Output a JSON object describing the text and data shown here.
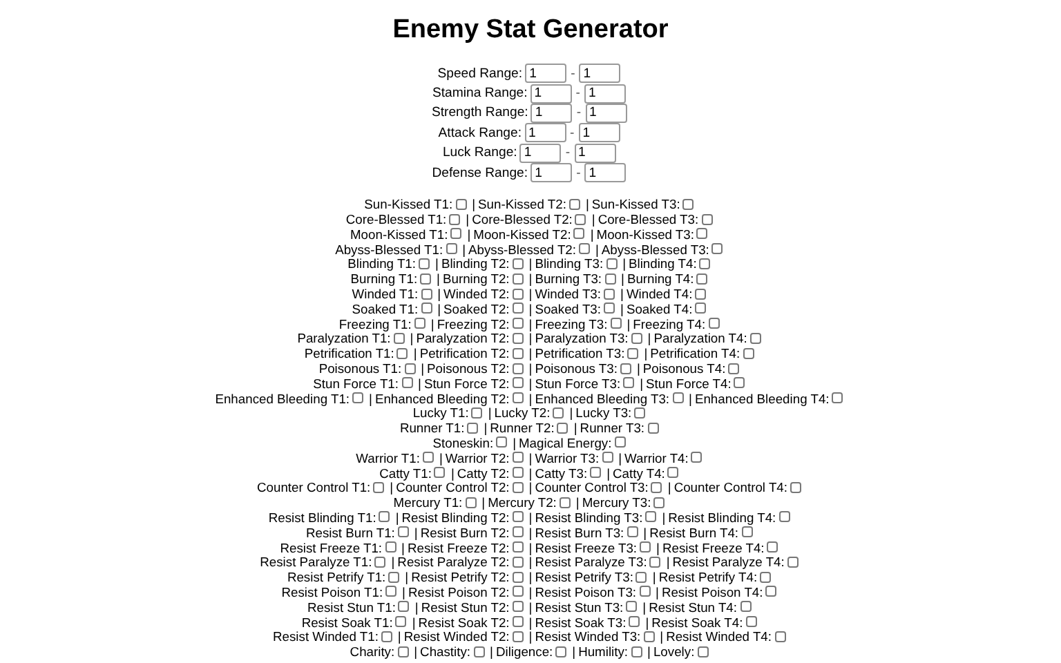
{
  "title": "Enemy Stat Generator",
  "range_dash": "-",
  "ranges": [
    {
      "label": "Speed Range:",
      "min": "1",
      "max": "1"
    },
    {
      "label": "Stamina Range:",
      "min": "1",
      "max": "1"
    },
    {
      "label": "Strength Range:",
      "min": "1",
      "max": "1"
    },
    {
      "label": "Attack Range:",
      "min": "1",
      "max": "1"
    },
    {
      "label": "Luck Range:",
      "min": "1",
      "max": "1"
    },
    {
      "label": "Defense Range:",
      "min": "1",
      "max": "1"
    }
  ],
  "separator": "|",
  "rows": [
    {
      "items": [
        {
          "label": "Sun-Kissed T1:",
          "checked": false
        },
        {
          "label": "Sun-Kissed T2:",
          "checked": false
        },
        {
          "label": "Sun-Kissed T3:",
          "checked": false
        }
      ]
    },
    {
      "items": [
        {
          "label": "Core-Blessed T1:",
          "checked": false
        },
        {
          "label": "Core-Blessed T2:",
          "checked": false
        },
        {
          "label": "Core-Blessed T3:",
          "checked": false
        }
      ]
    },
    {
      "items": [
        {
          "label": "Moon-Kissed T1:",
          "checked": false
        },
        {
          "label": "Moon-Kissed T2:",
          "checked": false
        },
        {
          "label": "Moon-Kissed T3:",
          "checked": false
        }
      ]
    },
    {
      "items": [
        {
          "label": "Abyss-Blessed T1:",
          "checked": false
        },
        {
          "label": "Abyss-Blessed T2:",
          "checked": false
        },
        {
          "label": "Abyss-Blessed T3:",
          "checked": false
        }
      ]
    },
    {
      "items": [
        {
          "label": "Blinding T1:",
          "checked": false
        },
        {
          "label": "Blinding T2:",
          "checked": false
        },
        {
          "label": "Blinding T3:",
          "checked": false
        },
        {
          "label": "Blinding T4:",
          "checked": false
        }
      ]
    },
    {
      "items": [
        {
          "label": "Burning T1:",
          "checked": false
        },
        {
          "label": "Burning T2:",
          "checked": false
        },
        {
          "label": "Burning T3:",
          "checked": false
        },
        {
          "label": "Burning T4:",
          "checked": false
        }
      ]
    },
    {
      "items": [
        {
          "label": "Winded T1:",
          "checked": false
        },
        {
          "label": "Winded T2:",
          "checked": false
        },
        {
          "label": "Winded T3:",
          "checked": false
        },
        {
          "label": "Winded T4:",
          "checked": false
        }
      ]
    },
    {
      "items": [
        {
          "label": "Soaked T1:",
          "checked": false
        },
        {
          "label": "Soaked T2:",
          "checked": false
        },
        {
          "label": "Soaked T3:",
          "checked": false
        },
        {
          "label": "Soaked T4:",
          "checked": false
        }
      ]
    },
    {
      "items": [
        {
          "label": "Freezing T1:",
          "checked": false
        },
        {
          "label": "Freezing T2:",
          "checked": false
        },
        {
          "label": "Freezing T3:",
          "checked": false
        },
        {
          "label": "Freezing T4:",
          "checked": false
        }
      ]
    },
    {
      "items": [
        {
          "label": "Paralyzation T1:",
          "checked": false
        },
        {
          "label": "Paralyzation T2:",
          "checked": false
        },
        {
          "label": "Paralyzation T3:",
          "checked": false
        },
        {
          "label": "Paralyzation T4:",
          "checked": false
        }
      ]
    },
    {
      "items": [
        {
          "label": "Petrification T1:",
          "checked": false
        },
        {
          "label": "Petrification T2:",
          "checked": false
        },
        {
          "label": "Petrification T3:",
          "checked": false
        },
        {
          "label": "Petrification T4:",
          "checked": false
        }
      ]
    },
    {
      "items": [
        {
          "label": "Poisonous T1:",
          "checked": false
        },
        {
          "label": "Poisonous T2:",
          "checked": false
        },
        {
          "label": "Poisonous T3:",
          "checked": false
        },
        {
          "label": "Poisonous T4:",
          "checked": false
        }
      ]
    },
    {
      "items": [
        {
          "label": "Stun Force T1:",
          "checked": false
        },
        {
          "label": "Stun Force T2:",
          "checked": false
        },
        {
          "label": "Stun Force T3:",
          "checked": false
        },
        {
          "label": "Stun Force T4:",
          "checked": false
        }
      ]
    },
    {
      "items": [
        {
          "label": "Enhanced Bleeding T1:",
          "checked": false
        },
        {
          "label": "Enhanced Bleeding T2:",
          "checked": false
        },
        {
          "label": "Enhanced Bleeding T3:",
          "checked": false
        },
        {
          "label": "Enhanced Bleeding T4:",
          "checked": false
        }
      ]
    },
    {
      "items": [
        {
          "label": "Lucky T1:",
          "checked": false
        },
        {
          "label": "Lucky T2:",
          "checked": false
        },
        {
          "label": "Lucky T3:",
          "checked": false
        }
      ]
    },
    {
      "items": [
        {
          "label": "Runner T1:",
          "checked": false
        },
        {
          "label": "Runner T2:",
          "checked": false
        },
        {
          "label": "Runner T3:",
          "checked": false
        }
      ]
    },
    {
      "items": [
        {
          "label": "Stoneskin:",
          "checked": false
        },
        {
          "label": "Magical Energy:",
          "checked": false
        }
      ]
    },
    {
      "items": [
        {
          "label": "Warrior T1:",
          "checked": false
        },
        {
          "label": "Warrior T2:",
          "checked": false
        },
        {
          "label": "Warrior T3:",
          "checked": false
        },
        {
          "label": "Warrior T4:",
          "checked": false
        }
      ]
    },
    {
      "items": [
        {
          "label": "Catty T1:",
          "checked": false
        },
        {
          "label": "Catty T2:",
          "checked": false
        },
        {
          "label": "Catty T3:",
          "checked": false
        },
        {
          "label": "Catty T4:",
          "checked": false
        }
      ]
    },
    {
      "items": [
        {
          "label": "Counter Control T1:",
          "checked": false
        },
        {
          "label": "Counter Control T2:",
          "checked": false
        },
        {
          "label": "Counter Control T3:",
          "checked": false
        },
        {
          "label": "Counter Control T4:",
          "checked": false
        }
      ]
    },
    {
      "items": [
        {
          "label": "Mercury T1:",
          "checked": false
        },
        {
          "label": "Mercury T2:",
          "checked": false
        },
        {
          "label": "Mercury T3:",
          "checked": false
        }
      ]
    },
    {
      "items": [
        {
          "label": "Resist Blinding T1:",
          "checked": false
        },
        {
          "label": "Resist Blinding T2:",
          "checked": false
        },
        {
          "label": "Resist Blinding T3:",
          "checked": false
        },
        {
          "label": "Resist Blinding T4:",
          "checked": false
        }
      ]
    },
    {
      "items": [
        {
          "label": "Resist Burn T1:",
          "checked": false
        },
        {
          "label": "Resist Burn T2:",
          "checked": false
        },
        {
          "label": "Resist Burn T3:",
          "checked": false
        },
        {
          "label": "Resist Burn T4:",
          "checked": false
        }
      ]
    },
    {
      "items": [
        {
          "label": "Resist Freeze T1:",
          "checked": false
        },
        {
          "label": "Resist Freeze T2:",
          "checked": false
        },
        {
          "label": "Resist Freeze T3:",
          "checked": false
        },
        {
          "label": "Resist Freeze T4:",
          "checked": false
        }
      ]
    },
    {
      "items": [
        {
          "label": "Resist Paralyze T1:",
          "checked": false
        },
        {
          "label": "Resist Paralyze T2:",
          "checked": false
        },
        {
          "label": "Resist Paralyze T3:",
          "checked": false
        },
        {
          "label": "Resist Paralyze T4:",
          "checked": false
        }
      ]
    },
    {
      "items": [
        {
          "label": "Resist Petrify T1:",
          "checked": false
        },
        {
          "label": "Resist Petrify T2:",
          "checked": false
        },
        {
          "label": "Resist Petrify T3:",
          "checked": false
        },
        {
          "label": "Resist Petrify T4:",
          "checked": false
        }
      ]
    },
    {
      "items": [
        {
          "label": "Resist Poison T1:",
          "checked": false
        },
        {
          "label": "Resist Poison T2:",
          "checked": false
        },
        {
          "label": "Resist Poison T3:",
          "checked": false
        },
        {
          "label": "Resist Poison T4:",
          "checked": false
        }
      ]
    },
    {
      "items": [
        {
          "label": "Resist Stun T1:",
          "checked": false
        },
        {
          "label": "Resist Stun T2:",
          "checked": false
        },
        {
          "label": "Resist Stun T3:",
          "checked": false
        },
        {
          "label": "Resist Stun T4:",
          "checked": false
        }
      ]
    },
    {
      "items": [
        {
          "label": "Resist Soak T1:",
          "checked": false
        },
        {
          "label": "Resist Soak T2:",
          "checked": false
        },
        {
          "label": "Resist Soak T3:",
          "checked": false
        },
        {
          "label": "Resist Soak T4:",
          "checked": false
        }
      ]
    },
    {
      "items": [
        {
          "label": "Resist Winded T1:",
          "checked": false
        },
        {
          "label": "Resist Winded T2:",
          "checked": false
        },
        {
          "label": "Resist Winded T3:",
          "checked": false
        },
        {
          "label": "Resist Winded T4:",
          "checked": false
        }
      ]
    },
    {
      "items": [
        {
          "label": "Charity:",
          "checked": false
        },
        {
          "label": "Chastity:",
          "checked": false
        },
        {
          "label": "Diligence:",
          "checked": false
        },
        {
          "label": "Humility:",
          "checked": false
        },
        {
          "label": "Lovely:",
          "checked": false
        }
      ]
    }
  ]
}
